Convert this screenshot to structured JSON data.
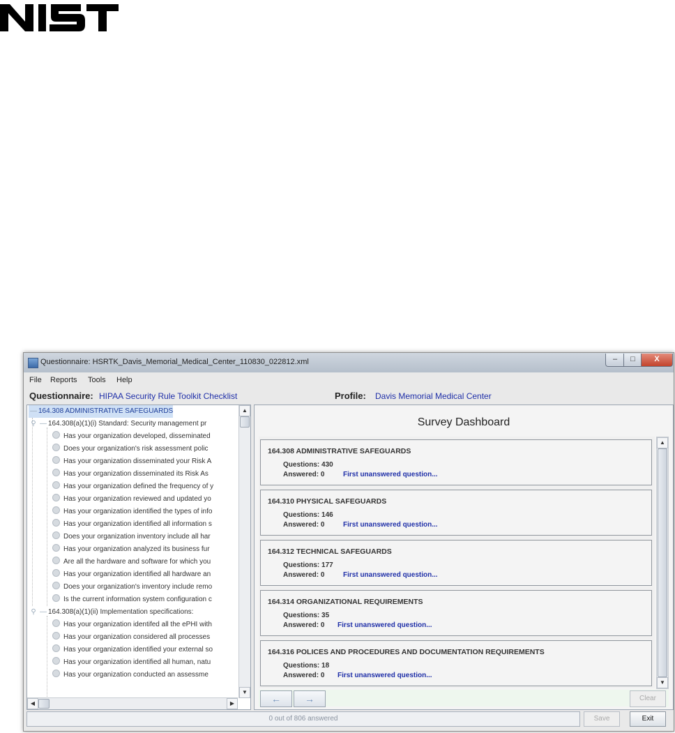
{
  "logo": {
    "text": "NIST"
  },
  "window": {
    "title": "Questionnaire: HSRTK_Davis_Memorial_Medical_Center_110830_022812.xml",
    "controls": {
      "minimize": "–",
      "maximize": "□",
      "close": "X"
    }
  },
  "menubar": {
    "file": "File",
    "reports": "Reports",
    "tools": "Tools",
    "help": "Help"
  },
  "header": {
    "questionnaire_label": "Questionnaire:",
    "questionnaire_value": "HIPAA Security Rule Toolkit Checklist",
    "profile_label": "Profile:",
    "profile_value": "Davis Memorial Medical Center"
  },
  "tree": {
    "nodes": [
      {
        "label": "164.308 ADMINISTRATIVE SAFEGUARDS",
        "selected": true
      },
      {
        "label": "164.308(a)(1)(i) Standard: Security management pr"
      },
      {
        "label": "Has your organization developed, disseminated"
      },
      {
        "label": "Does your organization's risk assessment polic"
      },
      {
        "label": "Has your organization disseminated your Risk A"
      },
      {
        "label": "Has your organization disseminated its Risk As"
      },
      {
        "label": "Has your organization defined the frequency of y"
      },
      {
        "label": "Has your organization reviewed and updated yo"
      },
      {
        "label": "Has your organization identified the types of info"
      },
      {
        "label": "Has your organization identified all information s"
      },
      {
        "label": "Does your organization inventory include all har"
      },
      {
        "label": "Has your organization analyzed its business fur"
      },
      {
        "label": "Are all the hardware and software for which you"
      },
      {
        "label": "Has your organization identified all hardware an"
      },
      {
        "label": "Does your organization's inventory include remo"
      },
      {
        "label": "Is the current information system configuration c"
      },
      {
        "label": "164.308(a)(1)(ii) Implementation specifications:"
      },
      {
        "label": "Has your organization identifed all the ePHI with"
      },
      {
        "label": "Has your organization considered all processes"
      },
      {
        "label": "Has your organization identified your external so"
      },
      {
        "label": "Has your organization identified all human, natu"
      },
      {
        "label": "Has your organization conducted an assessme"
      }
    ]
  },
  "dashboard": {
    "title": "Survey Dashboard",
    "cards": [
      {
        "title": "164.308 ADMINISTRATIVE SAFEGUARDS",
        "questions": "Questions: 430",
        "answered": "Answered: 0",
        "link": "First unanswered question..."
      },
      {
        "title": "164.310 PHYSICAL SAFEGUARDS",
        "questions": "Questions: 146",
        "answered": "Answered: 0",
        "link": "First unanswered question..."
      },
      {
        "title": "164.312 TECHNICAL SAFEGUARDS",
        "questions": "Questions: 177",
        "answered": "Answered: 0",
        "link": "First unanswered question..."
      },
      {
        "title": "164.314 ORGANIZATIONAL REQUIREMENTS",
        "questions": "Questions: 35",
        "answered": "Answered: 0",
        "link": "First unanswered question..."
      },
      {
        "title": "164.316 POLICES AND PROCEDURES AND DOCUMENTATION REQUIREMENTS",
        "questions": "Questions: 18",
        "answered": "Answered: 0",
        "link": "First unanswered question..."
      }
    ]
  },
  "nav": {
    "back": "←",
    "forward": "→",
    "clear": "Clear"
  },
  "status": {
    "text": "0 out of 806 answered"
  },
  "buttons": {
    "save": "Save",
    "exit": "Exit"
  }
}
